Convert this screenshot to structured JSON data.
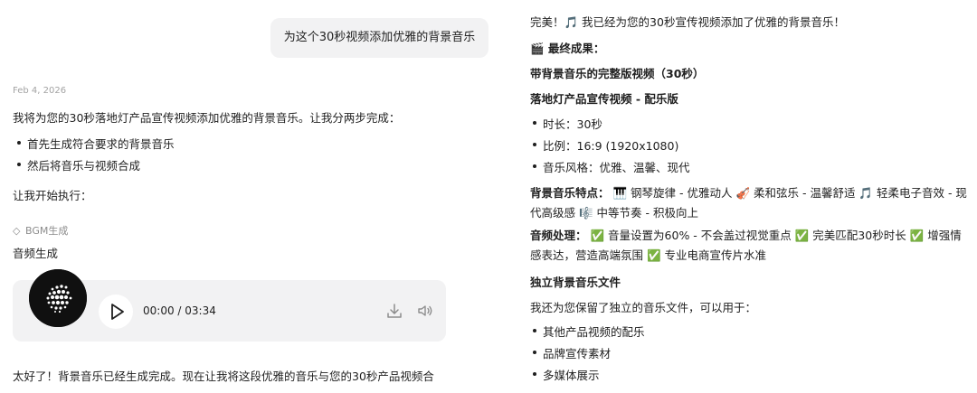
{
  "left": {
    "user_message": "为这个30秒视频添加优雅的背景音乐",
    "date": "Feb 4, 2026",
    "intro": "我将为您的30秒落地灯产品宣传视频添加优雅的背景音乐。让我分两步完成：",
    "steps": [
      "首先生成符合要求的背景音乐",
      "然后将音乐与视频合成"
    ],
    "start": "让我开始执行：",
    "tool_icon": "◇",
    "tool_name": "BGM生成",
    "section_title": "音频生成",
    "audio": {
      "time": "00:00 / 03:34"
    },
    "next_line": "太好了！背景音乐已经生成完成。现在让我将这段优雅的音乐与您的30秒产品视频合"
  },
  "right": {
    "done": "完美！🎵 我已经为您的30秒宣传视频添加了优雅的背景音乐！",
    "final_result": "🎬 最终成果：",
    "video_title": "带背景音乐的完整版视频（30秒）",
    "video_subtitle": "落地灯产品宣传视频 - 配乐版",
    "specs": [
      "时长：30秒",
      "比例：16:9 (1920x1080)",
      "音乐风格：优雅、温馨、现代"
    ],
    "features_label": "背景音乐特点：",
    "features_text": "🎹 钢琴旋律 - 优雅动人 🎻 柔和弦乐 - 温馨舒适 🎵 轻柔电子音效 - 现代高级感 🎼 中等节奏 - 积极向上",
    "processing_label": "音频处理：",
    "processing_text": "✅ 音量设置为60% - 不会盖过视觉重点 ✅ 完美匹配30秒时长 ✅ 增强情感表达，营造高端氛围 ✅ 专业电商宣传片水准",
    "file_title": "独立背景音乐文件",
    "file_intro": "我还为您保留了独立的音乐文件，可以用于：",
    "uses": [
      "其他产品视频的配乐",
      "品牌宣传素材",
      "多媒体展示"
    ]
  },
  "colors": {
    "bubble": "#f2f2f3",
    "muted": "#a3a3a3",
    "text": "#1f1f1f",
    "cover": "#101010"
  },
  "icons": {
    "play": "play-icon",
    "download": "download-icon",
    "volume": "volume-icon",
    "tool": "tool-icon"
  }
}
